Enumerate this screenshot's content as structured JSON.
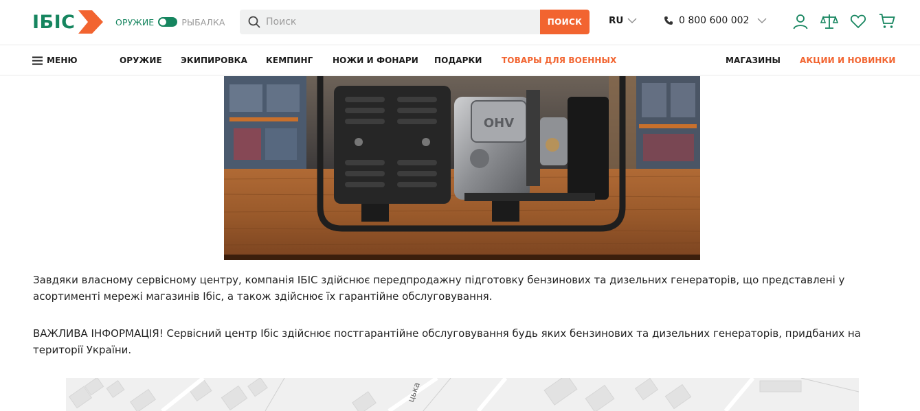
{
  "header": {
    "logo_text": "ІБІС",
    "toggle": {
      "left": "ОРУЖИЕ",
      "right": "РЫБАЛКА",
      "active": "left"
    },
    "search": {
      "placeholder": "Поиск",
      "button": "ПОИСК"
    },
    "language": "RU",
    "phone": "0 800 600 002",
    "icons": [
      "user-icon",
      "compare-icon",
      "heart-icon",
      "cart-icon"
    ]
  },
  "nav": {
    "menu_label": "МЕНЮ",
    "items": [
      {
        "label": "ОРУЖИЕ"
      },
      {
        "label": "ЭКИПИРОВКА"
      },
      {
        "label": "КЕМПИНГ"
      },
      {
        "label": "НОЖИ И ФОНАРИ"
      },
      {
        "label": "ПОДАРКИ"
      },
      {
        "label": "ТОВАРЫ ДЛЯ ВОЕННЫХ"
      },
      {
        "label": "МАГАЗИНЫ"
      },
      {
        "label": "АКЦИИ И НОВИНКИ"
      }
    ]
  },
  "content": {
    "hero_engine_label": "OHV",
    "paragraph_1": "Завдяки власному сервісному центру, компанія ІБІС здійснює передпродажну підготовку бензинових та дизельних генераторів, що представлені у асортименті мережі магазинів Ібіс, а також здійснює їх гарантійне обслуговування.",
    "paragraph_2": "ВАЖЛИВА ІНФОРМАЦІЯ! Сервісний центр Ібіс здійснює постгарантійне обслуговування будь яких бензинових та дизельних генераторів, придбаних на території України.",
    "map_street_label": "цька"
  },
  "colors": {
    "brand_green": "#16855f",
    "accent_orange": "#f26430",
    "search_bg": "#f0f1f1"
  }
}
